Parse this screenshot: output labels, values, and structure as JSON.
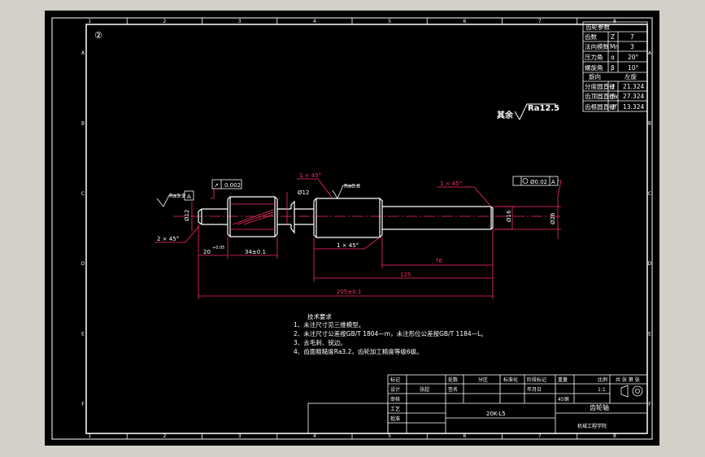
{
  "colors": {
    "background": "#d4d0c8",
    "sheet": "#000000",
    "line": "#ffffff",
    "dimension": "#ff2e63",
    "centerline": "#ff2e63"
  },
  "zone_numbers_top": [
    "1",
    "2",
    "3",
    "4",
    "5",
    "6",
    "7",
    "8"
  ],
  "zone_numbers_bottom": [
    "1",
    "2",
    "3",
    "4",
    "5",
    "6",
    "7",
    "8"
  ],
  "zone_letters_left": [
    "A",
    "B",
    "C",
    "D",
    "E",
    "F"
  ],
  "zone_letters_right": [
    "A",
    "B",
    "C",
    "D",
    "E",
    "F"
  ],
  "view_marker": "②",
  "gear_table": {
    "title": "齿轮参数",
    "rows": [
      {
        "name": "齿数",
        "sym": "Z",
        "val": "7"
      },
      {
        "name": "法向模数",
        "sym": "Mn",
        "val": "3"
      },
      {
        "name": "压力角",
        "sym": "α",
        "val": "20°"
      },
      {
        "name": "螺旋角",
        "sym": "β",
        "val": "10°"
      },
      {
        "name": "旋向",
        "sym": "",
        "val": "左旋"
      },
      {
        "name": "分度圆直径",
        "sym": "d",
        "val": "21.324"
      },
      {
        "name": "齿顶圆直径",
        "sym": "da",
        "val": "27.324"
      },
      {
        "name": "齿根圆直径",
        "sym": "df",
        "val": "13.324"
      }
    ]
  },
  "roughness_other": {
    "label": "其余",
    "value": "Ra12.5"
  },
  "annotations": {
    "chamfer_top_mid": "1 × 45°",
    "chamfer_top_right": "1 × 45°",
    "chamfer_left": "2 × 45°",
    "chamfer_bottom_mid": "1 × 45°",
    "dia_neck": "Ø12",
    "dia_left_end": "Ø12",
    "dia_right": "Ø16",
    "dia_right_end": "Ø26",
    "roughness_left": "Ra3.2",
    "roughness_mid": "Ra0.8",
    "datum_left": "A",
    "datum_right": "A",
    "runout_tol": "0.002",
    "position_tol": "Ø0.02",
    "dim_20": "20",
    "dim_20_tol": "+0.05",
    "dim_34": "34±0.1",
    "dim_76": "76",
    "dim_125": "125",
    "dim_total": "205±0.1"
  },
  "tech_req": {
    "title": "技术要求",
    "lines": [
      "1、未注尺寸见三维模型。",
      "2、未注尺寸公差按GB/T 1804—m，未注形位公差按GB/T 1184—L。",
      "3、去毛刺、锐边。",
      "4、齿面粗糙度Ra3.2，齿轮加工精度等级6级。"
    ]
  },
  "title_block": {
    "c_mark": "标记",
    "c_process": "处数",
    "c_design": "设计",
    "c_check": "审核",
    "c_craft": "工艺",
    "c_approve": "批准",
    "c_part": "分区",
    "c_std": "标准化",
    "c_sign": "签名",
    "c_date": "年月日",
    "c_stage": "阶段标记",
    "c_weight": "重量",
    "c_scale": "比例",
    "c_sheet": "共 张 第 张",
    "drawing_no": "20K-L5",
    "material": "45钢",
    "scale": "1:1",
    "name": "齿轮轴",
    "company": "机械工程学院",
    "designer": "张超"
  }
}
